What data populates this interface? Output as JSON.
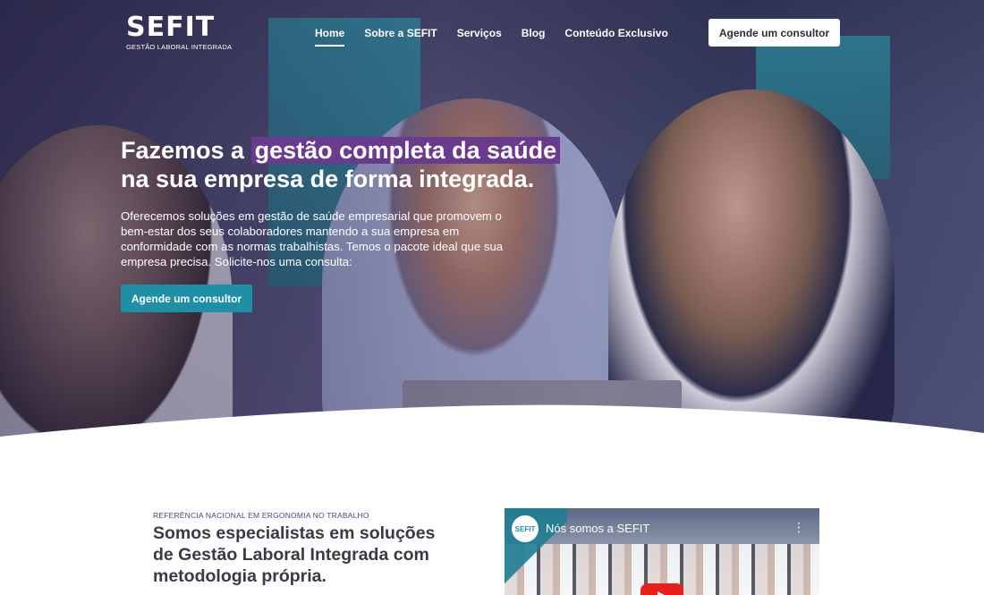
{
  "brand": {
    "name": "SEFIT",
    "tagline": "GESTÃO LABORAL INTEGRADA"
  },
  "nav": {
    "items": [
      {
        "label": "Home",
        "active": true
      },
      {
        "label": "Sobre a SEFIT",
        "active": false
      },
      {
        "label": "Serviços",
        "active": false
      },
      {
        "label": "Blog",
        "active": false
      },
      {
        "label": "Conteúdo Exclusivo",
        "active": false
      }
    ],
    "cta_label": "Agende um consultor"
  },
  "hero": {
    "headline_pre": "Fazemos a",
    "headline_highlight": "gestão completa da saúde",
    "headline_post": "na sua empresa de forma integrada.",
    "lead": "Oferecemos soluções em gestão de saúde empresarial que promovem o bem-estar dos seus colaboradores mantendo a sua empresa em conformidade com as normas trabalhistas. Temos o pacote ideal que sua empresa precisa. Solicite-nos uma consulta:",
    "cta_label": "Agende um consultor"
  },
  "about": {
    "eyebrow": "REFERÊNCIA NACIONAL EM ERGONOMIA NO TRABALHO",
    "title": "Somos especialistas em soluções de Gestão Laboral Integrada com metodologia própria."
  },
  "video": {
    "channel_badge": "SEFIT",
    "title": "Nós somos a SEFIT",
    "more_icon": "⋮"
  },
  "colors": {
    "highlight": "#6a3a8e",
    "accent": "#1f8fa6",
    "eyebrow": "#5a3a7c",
    "title_text": "#3a3a44"
  }
}
